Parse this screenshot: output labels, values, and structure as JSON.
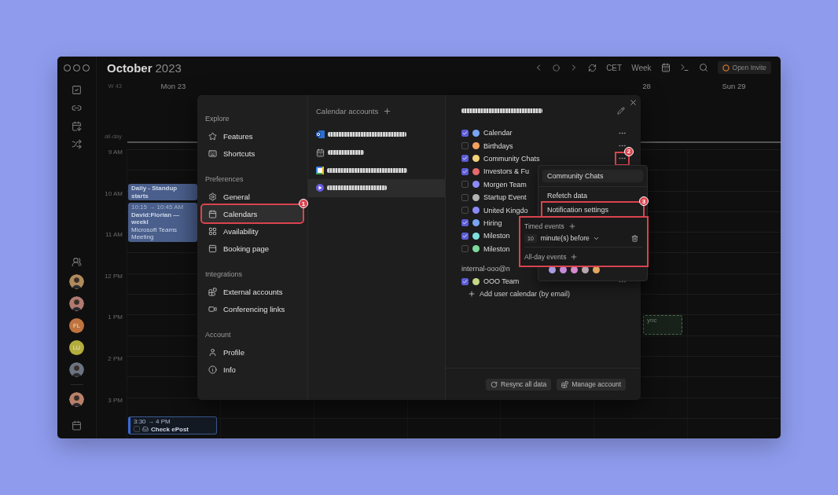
{
  "toolbar": {
    "month": "October",
    "year": "2023",
    "timezone": "CET",
    "view": "Week",
    "invite_button": "Open Invite"
  },
  "rail": {
    "avatars": [
      {
        "kind": "photo",
        "color": "#b08a5a"
      },
      {
        "kind": "photo",
        "color": "#b07a70"
      },
      {
        "kind": "initials",
        "initials": "FL",
        "color": "#c0733f"
      },
      {
        "kind": "initials",
        "initials": "LU",
        "color": "#b3ad3c"
      },
      {
        "kind": "photo",
        "color": "#6b7480"
      }
    ],
    "me": {
      "kind": "photo",
      "color": "#b8806a"
    }
  },
  "calendar": {
    "week": "W 43",
    "day_headers": [
      "Mon 23",
      "28",
      "Sun 29"
    ],
    "all_day_label": "all-day",
    "hours": [
      "9 AM",
      "10 AM",
      "11 AM",
      "12 PM",
      "1 PM",
      "2 PM",
      "3 PM"
    ],
    "events": [
      {
        "kind": "solid",
        "title": "Daily - Standup starts"
      },
      {
        "kind": "solid",
        "time": "10:15 → 10:45 AM",
        "title": "David:Florian — weekl",
        "subtitle": "Microsoft Teams Meeting"
      },
      {
        "kind": "task",
        "time": "3:30 → 4 PM",
        "title": "Check ePost",
        "checked": false
      },
      {
        "kind": "dashed",
        "title": "ync"
      }
    ]
  },
  "settings": {
    "nav": [
      {
        "heading": "Explore",
        "items": [
          {
            "label": "Features",
            "selected": false
          },
          {
            "label": "Shortcuts",
            "selected": false
          }
        ]
      },
      {
        "heading": "Preferences",
        "items": [
          {
            "label": "General",
            "selected": false
          },
          {
            "label": "Calendars",
            "selected": true,
            "callout": "1"
          },
          {
            "label": "Availability",
            "selected": false
          },
          {
            "label": "Booking page",
            "selected": false
          }
        ]
      },
      {
        "heading": "Integrations",
        "items": [
          {
            "label": "External accounts",
            "selected": false
          },
          {
            "label": "Conferencing links",
            "selected": false
          }
        ]
      },
      {
        "heading": "Account",
        "items": [
          {
            "label": "Profile",
            "selected": false
          },
          {
            "label": "Info",
            "selected": false
          }
        ]
      }
    ],
    "accounts_heading": "Calendar accounts",
    "accounts": [
      {
        "kind": "outlook",
        "selected": false
      },
      {
        "kind": "ical",
        "selected": false
      },
      {
        "kind": "google",
        "selected": false
      },
      {
        "kind": "morgen",
        "selected": true
      }
    ],
    "calendars": [
      {
        "name": "Calendar",
        "checked": true,
        "color": "#7aa5f2",
        "more_button": true
      },
      {
        "name": "Birthdays",
        "checked": false,
        "color": "#f0a35e",
        "more_button": true
      },
      {
        "name": "Community Chats",
        "checked": true,
        "color": "#f4d47a",
        "more_button": true,
        "callout": "2"
      },
      {
        "name": "Investors & Fu",
        "checked": true,
        "color": "#e86a6a",
        "more_button": false
      },
      {
        "name": "Morgen Team",
        "checked": false,
        "color": "#8c8cf2",
        "more_button": false
      },
      {
        "name": "Startup Event",
        "checked": false,
        "color": "#b4b4b4",
        "more_button": false
      },
      {
        "name": "United Kingdo",
        "checked": false,
        "color": "#8a8af6",
        "more_button": false
      },
      {
        "name": "Hiring",
        "checked": true,
        "color": "#7aa5f2",
        "more_button": false
      },
      {
        "name": "Mileston",
        "checked": true,
        "color": "#80e0e0",
        "more_button": false
      },
      {
        "name": "Mileston",
        "checked": false,
        "color": "#7fd99b",
        "more_button": false
      }
    ],
    "shared_heading": "internal-ooo@n",
    "shared_calendars": [
      {
        "name": "OOO Team",
        "checked": true,
        "color": "#c5d98a",
        "more_button": true
      }
    ],
    "add_link": "Add user calendar (by email)",
    "footer_buttons": [
      {
        "label": "Resync all data",
        "kind": "resync"
      },
      {
        "label": "Manage account",
        "kind": "manage"
      }
    ]
  },
  "menu": {
    "title_field": "Community Chats",
    "items": [
      {
        "label": "Refetch data"
      },
      {
        "label": "Notification settings",
        "callout": "3"
      }
    ],
    "swatches": [
      {
        "color": "#a99be0"
      },
      {
        "color": "#c58ad8"
      },
      {
        "color": "#d48acb"
      },
      {
        "color": "#b9a7b0"
      },
      {
        "color": "#e0a860"
      }
    ]
  },
  "notifications": {
    "highlighted": true,
    "timed_label": "Timed events",
    "reminder": {
      "value": "10",
      "unit": "minute(s) before"
    },
    "all_day_label": "All-day events"
  }
}
